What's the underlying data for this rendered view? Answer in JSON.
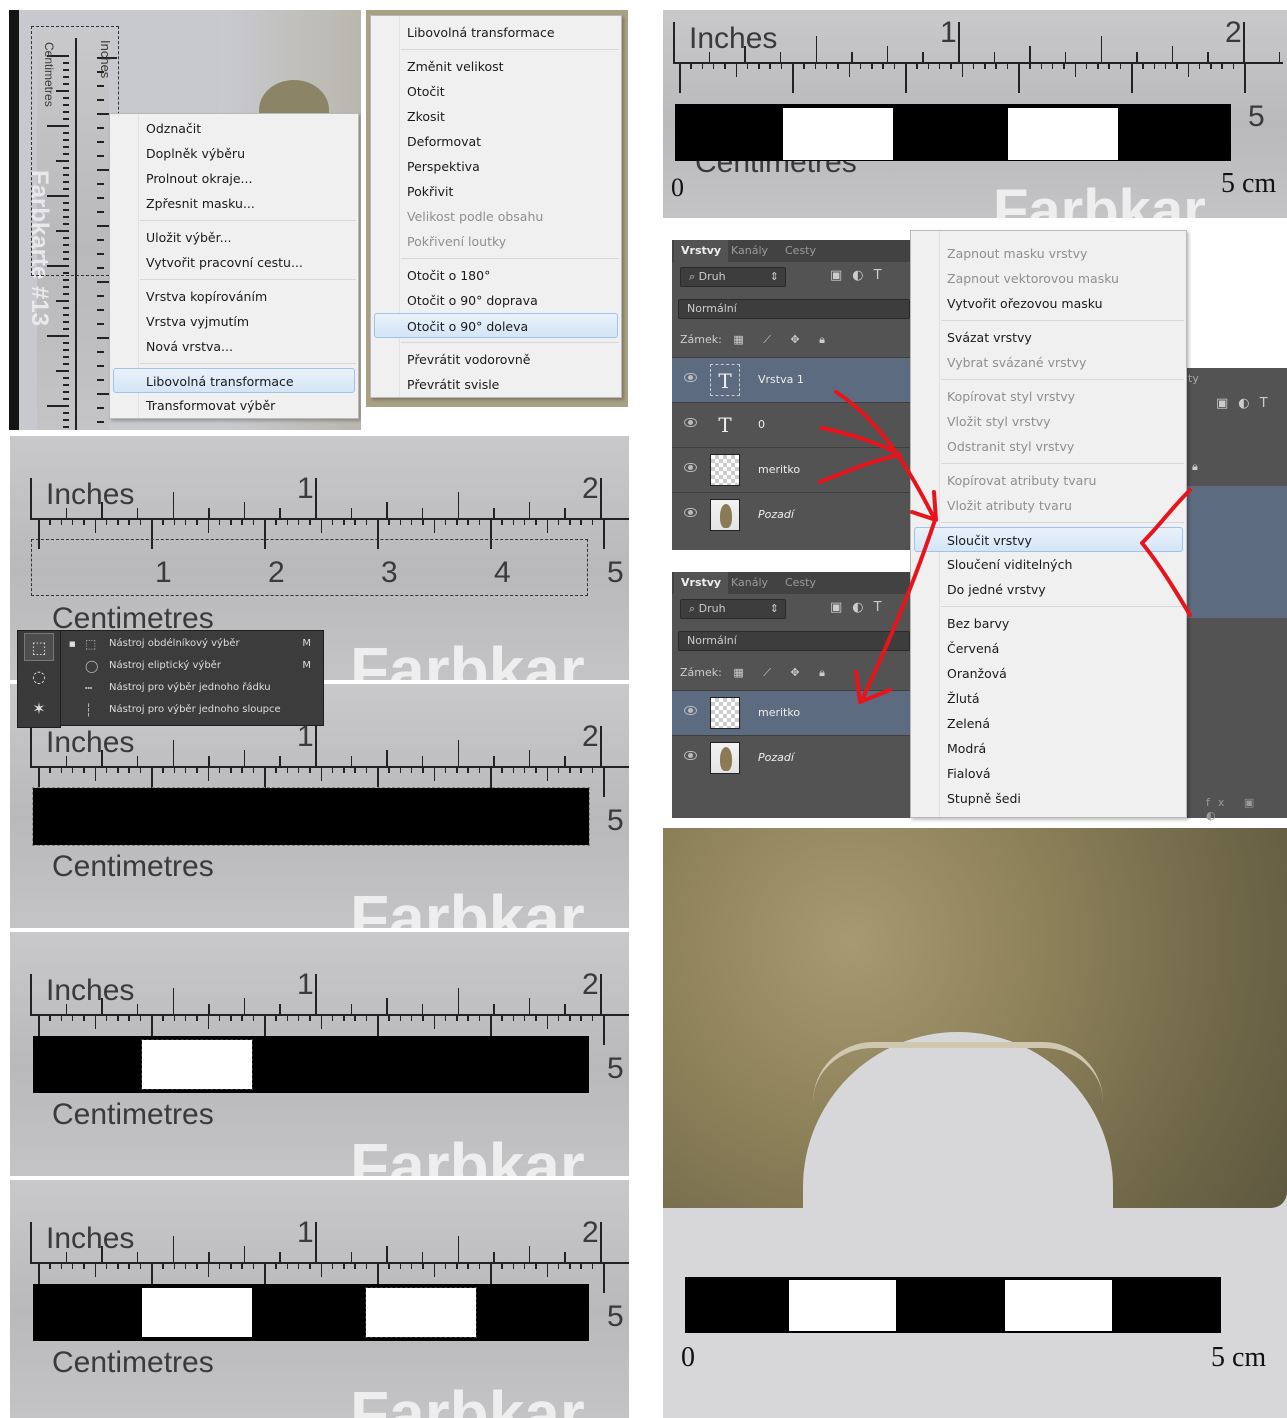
{
  "ruler": {
    "inches_label": "Inches",
    "centimetres_label": "Centimetres",
    "brand_label": "Farbkar",
    "brand_vertical": "Farbkarte #13",
    "inch_numbers": [
      "1",
      "2"
    ],
    "cm_numbers": [
      "1",
      "2",
      "3",
      "4",
      "5"
    ]
  },
  "context_menu_selection": {
    "items": [
      {
        "label": "Odznačit"
      },
      {
        "label": "Doplněk výběru"
      },
      {
        "label": "Prolnout okraje..."
      },
      {
        "label": "Zpřesnit masku..."
      },
      {
        "label": "Uložit výběr..."
      },
      {
        "label": "Vytvořit pracovní cestu..."
      },
      {
        "label": "Vrstva kopírováním"
      },
      {
        "label": "Vrstva vyjmutím"
      },
      {
        "label": "Nová vrstva..."
      },
      {
        "label": "Libovolná transformace",
        "highlighted": true
      },
      {
        "label": "Transformovat výběr"
      }
    ]
  },
  "context_menu_transform": {
    "items": [
      {
        "label": "Libovolná transformace"
      },
      {
        "label": "Změnit velikost"
      },
      {
        "label": "Otočit"
      },
      {
        "label": "Zkosit"
      },
      {
        "label": "Deformovat"
      },
      {
        "label": "Perspektiva"
      },
      {
        "label": "Pokřivit"
      },
      {
        "label": "Velikost podle obsahu",
        "disabled": true
      },
      {
        "label": "Pokřivení loutky",
        "disabled": true
      },
      {
        "label": "Otočit o 180°"
      },
      {
        "label": "Otočit o 90° doprava"
      },
      {
        "label": "Otočit o 90° doleva",
        "highlighted": true
      },
      {
        "label": "Převrátit vodorovně"
      },
      {
        "label": "Převrátit svisle"
      }
    ]
  },
  "scale_bar": {
    "zero_label": "0",
    "end_label": "5 cm",
    "end_digit": "5"
  },
  "tool_flyout": {
    "items": [
      {
        "label": "Nástroj obdélníkový výběr",
        "key": "M"
      },
      {
        "label": "Nástroj eliptický výběr",
        "key": "M"
      },
      {
        "label": "Nástroj pro výběr jednoho řádku",
        "key": ""
      },
      {
        "label": "Nástroj pro výběr jednoho sloupce",
        "key": ""
      }
    ]
  },
  "layers_panel": {
    "tabs": [
      "Vrstvy",
      "Kanály",
      "Cesty"
    ],
    "filter_label": "Druh",
    "blend_mode": "Normální",
    "lock_label": "Zámek:",
    "layers_before": [
      {
        "name": "Vrstva 1",
        "kind": "text",
        "selected": true
      },
      {
        "name": "0",
        "kind": "text"
      },
      {
        "name": "meritko",
        "kind": "pixel"
      },
      {
        "name": "Pozadí",
        "kind": "background"
      }
    ],
    "layers_after": [
      {
        "name": "meritko",
        "kind": "pixel",
        "selected": true
      },
      {
        "name": "Pozadí",
        "kind": "background"
      }
    ],
    "behind_tab_fragment": "ty"
  },
  "context_menu_layers": {
    "items": [
      {
        "label": "Zapnout masku vrstvy",
        "disabled": true
      },
      {
        "label": "Zapnout vektorovou masku",
        "disabled": true
      },
      {
        "label": "Vytvořit ořezovou masku"
      },
      {
        "label": "Svázat vrstvy"
      },
      {
        "label": "Vybrat svázané vrstvy",
        "disabled": true
      },
      {
        "label": "Kopírovat styl vrstvy",
        "disabled": true
      },
      {
        "label": "Vložit styl vrstvy",
        "disabled": true
      },
      {
        "label": "Odstranit styl vrstvy",
        "disabled": true
      },
      {
        "label": "Kopírovat atributy tvaru",
        "disabled": true
      },
      {
        "label": "Vložit atributy tvaru",
        "disabled": true
      },
      {
        "label": "Sloučit vrstvy",
        "highlighted": true
      },
      {
        "label": "Sloučení viditelných"
      },
      {
        "label": "Do jedné vrstvy"
      },
      {
        "label": "Bez barvy"
      },
      {
        "label": "Červená"
      },
      {
        "label": "Oranžová"
      },
      {
        "label": "Žlutá"
      },
      {
        "label": "Zelená"
      },
      {
        "label": "Modrá"
      },
      {
        "label": "Fialová"
      },
      {
        "label": "Stupně šedi"
      }
    ]
  },
  "colors": {
    "annotation": "#e8141c",
    "highlight": "#d4e5f7",
    "ps_panel": "#535353",
    "ps_selected_layer": "#5d6b80"
  }
}
